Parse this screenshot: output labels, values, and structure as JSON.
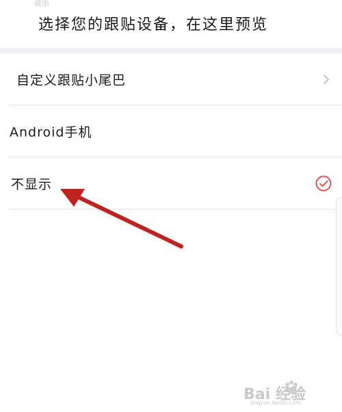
{
  "header": {
    "partial_caption": "说示",
    "preview_text": "选择您的跟贴设备，在这里预览"
  },
  "options": [
    {
      "label": "自定义跟贴小尾巴",
      "trailing": "chevron-right-icon"
    },
    {
      "label": "Android手机",
      "trailing": ""
    },
    {
      "label": "不显示",
      "trailing": "check-circle-icon",
      "selected": true
    }
  ],
  "colors": {
    "accent": "#e8423f",
    "annotation_arrow": "#c0231e",
    "divider": "#e8e8e8",
    "band": "#efeff4"
  },
  "watermark": {
    "logo": "Bai 经验",
    "url": "jingyan.baidu.com"
  }
}
